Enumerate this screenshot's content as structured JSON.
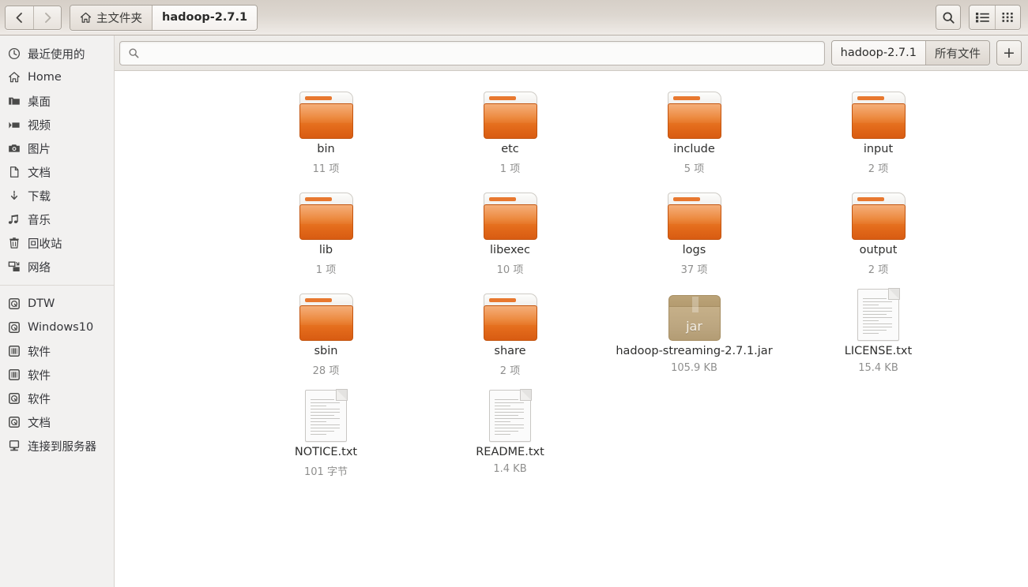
{
  "header": {
    "nav": {
      "back_label": "‹",
      "forward_label": "›"
    },
    "breadcrumbs": [
      {
        "label": "主文件夹",
        "icon": "home-icon",
        "active": false
      },
      {
        "label": "hadoop-2.7.1",
        "icon": null,
        "active": true
      }
    ],
    "buttons": {
      "search_icon": "search-icon",
      "list_view_icon": "list-view-icon",
      "grid_view_icon": "grid-view-icon"
    }
  },
  "search": {
    "value": "",
    "placeholder": "",
    "icon": "search-icon"
  },
  "tabs": [
    {
      "label": "hadoop-2.7.1",
      "active": true
    },
    {
      "label": "所有文件",
      "active": false
    }
  ],
  "new_tab_label": "+",
  "sidebar": {
    "groups": [
      {
        "items": [
          {
            "label": "最近使用的",
            "icon": "clock-icon"
          },
          {
            "label": "Home",
            "icon": "home-icon"
          },
          {
            "label": "桌面",
            "icon": "folder-icon"
          },
          {
            "label": "视频",
            "icon": "video-icon"
          },
          {
            "label": "图片",
            "icon": "camera-icon"
          },
          {
            "label": "文档",
            "icon": "document-icon"
          },
          {
            "label": "下载",
            "icon": "download-icon"
          },
          {
            "label": "音乐",
            "icon": "music-icon"
          },
          {
            "label": "回收站",
            "icon": "trash-icon"
          },
          {
            "label": "网络",
            "icon": "network-icon"
          }
        ]
      },
      {
        "items": [
          {
            "label": "DTW",
            "icon": "disk-icon"
          },
          {
            "label": "Windows10",
            "icon": "disk-icon"
          },
          {
            "label": "软件",
            "icon": "drive-icon"
          },
          {
            "label": "软件",
            "icon": "drive-icon"
          },
          {
            "label": "软件",
            "icon": "disk-icon"
          },
          {
            "label": "文档",
            "icon": "disk-icon"
          },
          {
            "label": "连接到服务器",
            "icon": "server-icon"
          }
        ]
      }
    ]
  },
  "files": [
    {
      "name": "bin",
      "meta": "11 项",
      "type": "folder"
    },
    {
      "name": "etc",
      "meta": "1 项",
      "type": "folder"
    },
    {
      "name": "include",
      "meta": "5 项",
      "type": "folder"
    },
    {
      "name": "input",
      "meta": "2 项",
      "type": "folder"
    },
    {
      "name": "lib",
      "meta": "1 项",
      "type": "folder"
    },
    {
      "name": "libexec",
      "meta": "10 项",
      "type": "folder"
    },
    {
      "name": "logs",
      "meta": "37 项",
      "type": "folder"
    },
    {
      "name": "output",
      "meta": "2 项",
      "type": "folder"
    },
    {
      "name": "sbin",
      "meta": "28 项",
      "type": "folder"
    },
    {
      "name": "share",
      "meta": "2 项",
      "type": "folder"
    },
    {
      "name": "hadoop-streaming-2.7.1.jar",
      "meta": "105.9 KB",
      "type": "jar",
      "icon_label": "jar"
    },
    {
      "name": "LICENSE.txt",
      "meta": "15.4 KB",
      "type": "text"
    },
    {
      "name": "NOTICE.txt",
      "meta": "101 字节",
      "type": "text"
    },
    {
      "name": "README.txt",
      "meta": "1.4 KB",
      "type": "text"
    }
  ],
  "colors": {
    "folder_orange": "#e8782f",
    "jar_tan": "#bca680",
    "header_bg": "#ddd7d0",
    "sidebar_bg": "#f2f1f0",
    "content_bg": "#ffffff"
  }
}
